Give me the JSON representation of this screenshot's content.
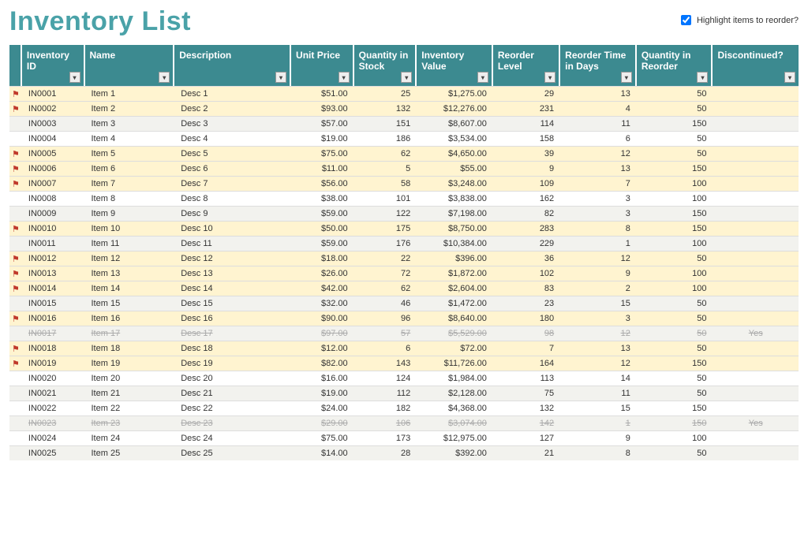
{
  "title": "Inventory List",
  "highlight_label": "Highlight items to reorder?",
  "highlight_checked": true,
  "columns": [
    "Inventory ID",
    "Name",
    "Description",
    "Unit Price",
    "Quantity in Stock",
    "Inventory Value",
    "Reorder Level",
    "Reorder Time in Days",
    "Quantity in Reorder",
    "Discontinued?"
  ],
  "rows": [
    {
      "flag": true,
      "id": "IN0001",
      "name": "Item 1",
      "desc": "Desc 1",
      "price": "$51.00",
      "qty": "25",
      "value": "$1,275.00",
      "reorder": "29",
      "time": "13",
      "qro": "50",
      "disc": ""
    },
    {
      "flag": true,
      "id": "IN0002",
      "name": "Item 2",
      "desc": "Desc 2",
      "price": "$93.00",
      "qty": "132",
      "value": "$12,276.00",
      "reorder": "231",
      "time": "4",
      "qro": "50",
      "disc": ""
    },
    {
      "flag": false,
      "id": "IN0003",
      "name": "Item 3",
      "desc": "Desc 3",
      "price": "$57.00",
      "qty": "151",
      "value": "$8,607.00",
      "reorder": "114",
      "time": "11",
      "qro": "150",
      "disc": ""
    },
    {
      "flag": false,
      "id": "IN0004",
      "name": "Item 4",
      "desc": "Desc 4",
      "price": "$19.00",
      "qty": "186",
      "value": "$3,534.00",
      "reorder": "158",
      "time": "6",
      "qro": "50",
      "disc": ""
    },
    {
      "flag": true,
      "id": "IN0005",
      "name": "Item 5",
      "desc": "Desc 5",
      "price": "$75.00",
      "qty": "62",
      "value": "$4,650.00",
      "reorder": "39",
      "time": "12",
      "qro": "50",
      "disc": ""
    },
    {
      "flag": true,
      "id": "IN0006",
      "name": "Item 6",
      "desc": "Desc 6",
      "price": "$11.00",
      "qty": "5",
      "value": "$55.00",
      "reorder": "9",
      "time": "13",
      "qro": "150",
      "disc": ""
    },
    {
      "flag": true,
      "id": "IN0007",
      "name": "Item 7",
      "desc": "Desc 7",
      "price": "$56.00",
      "qty": "58",
      "value": "$3,248.00",
      "reorder": "109",
      "time": "7",
      "qro": "100",
      "disc": ""
    },
    {
      "flag": false,
      "id": "IN0008",
      "name": "Item 8",
      "desc": "Desc 8",
      "price": "$38.00",
      "qty": "101",
      "value": "$3,838.00",
      "reorder": "162",
      "time": "3",
      "qro": "100",
      "disc": ""
    },
    {
      "flag": false,
      "id": "IN0009",
      "name": "Item 9",
      "desc": "Desc 9",
      "price": "$59.00",
      "qty": "122",
      "value": "$7,198.00",
      "reorder": "82",
      "time": "3",
      "qro": "150",
      "disc": ""
    },
    {
      "flag": true,
      "id": "IN0010",
      "name": "Item 10",
      "desc": "Desc 10",
      "price": "$50.00",
      "qty": "175",
      "value": "$8,750.00",
      "reorder": "283",
      "time": "8",
      "qro": "150",
      "disc": ""
    },
    {
      "flag": false,
      "id": "IN0011",
      "name": "Item 11",
      "desc": "Desc 11",
      "price": "$59.00",
      "qty": "176",
      "value": "$10,384.00",
      "reorder": "229",
      "time": "1",
      "qro": "100",
      "disc": ""
    },
    {
      "flag": true,
      "id": "IN0012",
      "name": "Item 12",
      "desc": "Desc 12",
      "price": "$18.00",
      "qty": "22",
      "value": "$396.00",
      "reorder": "36",
      "time": "12",
      "qro": "50",
      "disc": ""
    },
    {
      "flag": true,
      "id": "IN0013",
      "name": "Item 13",
      "desc": "Desc 13",
      "price": "$26.00",
      "qty": "72",
      "value": "$1,872.00",
      "reorder": "102",
      "time": "9",
      "qro": "100",
      "disc": ""
    },
    {
      "flag": true,
      "id": "IN0014",
      "name": "Item 14",
      "desc": "Desc 14",
      "price": "$42.00",
      "qty": "62",
      "value": "$2,604.00",
      "reorder": "83",
      "time": "2",
      "qro": "100",
      "disc": ""
    },
    {
      "flag": false,
      "id": "IN0015",
      "name": "Item 15",
      "desc": "Desc 15",
      "price": "$32.00",
      "qty": "46",
      "value": "$1,472.00",
      "reorder": "23",
      "time": "15",
      "qro": "50",
      "disc": ""
    },
    {
      "flag": true,
      "id": "IN0016",
      "name": "Item 16",
      "desc": "Desc 16",
      "price": "$90.00",
      "qty": "96",
      "value": "$8,640.00",
      "reorder": "180",
      "time": "3",
      "qro": "50",
      "disc": ""
    },
    {
      "flag": false,
      "id": "IN0017",
      "name": "Item 17",
      "desc": "Desc 17",
      "price": "$97.00",
      "qty": "57",
      "value": "$5,529.00",
      "reorder": "98",
      "time": "12",
      "qro": "50",
      "disc": "Yes",
      "discontinued": true
    },
    {
      "flag": true,
      "id": "IN0018",
      "name": "Item 18",
      "desc": "Desc 18",
      "price": "$12.00",
      "qty": "6",
      "value": "$72.00",
      "reorder": "7",
      "time": "13",
      "qro": "50",
      "disc": ""
    },
    {
      "flag": true,
      "id": "IN0019",
      "name": "Item 19",
      "desc": "Desc 19",
      "price": "$82.00",
      "qty": "143",
      "value": "$11,726.00",
      "reorder": "164",
      "time": "12",
      "qro": "150",
      "disc": ""
    },
    {
      "flag": false,
      "id": "IN0020",
      "name": "Item 20",
      "desc": "Desc 20",
      "price": "$16.00",
      "qty": "124",
      "value": "$1,984.00",
      "reorder": "113",
      "time": "14",
      "qro": "50",
      "disc": ""
    },
    {
      "flag": false,
      "id": "IN0021",
      "name": "Item 21",
      "desc": "Desc 21",
      "price": "$19.00",
      "qty": "112",
      "value": "$2,128.00",
      "reorder": "75",
      "time": "11",
      "qro": "50",
      "disc": ""
    },
    {
      "flag": false,
      "id": "IN0022",
      "name": "Item 22",
      "desc": "Desc 22",
      "price": "$24.00",
      "qty": "182",
      "value": "$4,368.00",
      "reorder": "132",
      "time": "15",
      "qro": "150",
      "disc": ""
    },
    {
      "flag": false,
      "id": "IN0023",
      "name": "Item 23",
      "desc": "Desc 23",
      "price": "$29.00",
      "qty": "106",
      "value": "$3,074.00",
      "reorder": "142",
      "time": "1",
      "qro": "150",
      "disc": "Yes",
      "discontinued": true
    },
    {
      "flag": false,
      "id": "IN0024",
      "name": "Item 24",
      "desc": "Desc 24",
      "price": "$75.00",
      "qty": "173",
      "value": "$12,975.00",
      "reorder": "127",
      "time": "9",
      "qro": "100",
      "disc": ""
    },
    {
      "flag": false,
      "id": "IN0025",
      "name": "Item 25",
      "desc": "Desc 25",
      "price": "$14.00",
      "qty": "28",
      "value": "$392.00",
      "reorder": "21",
      "time": "8",
      "qro": "50",
      "disc": ""
    }
  ]
}
